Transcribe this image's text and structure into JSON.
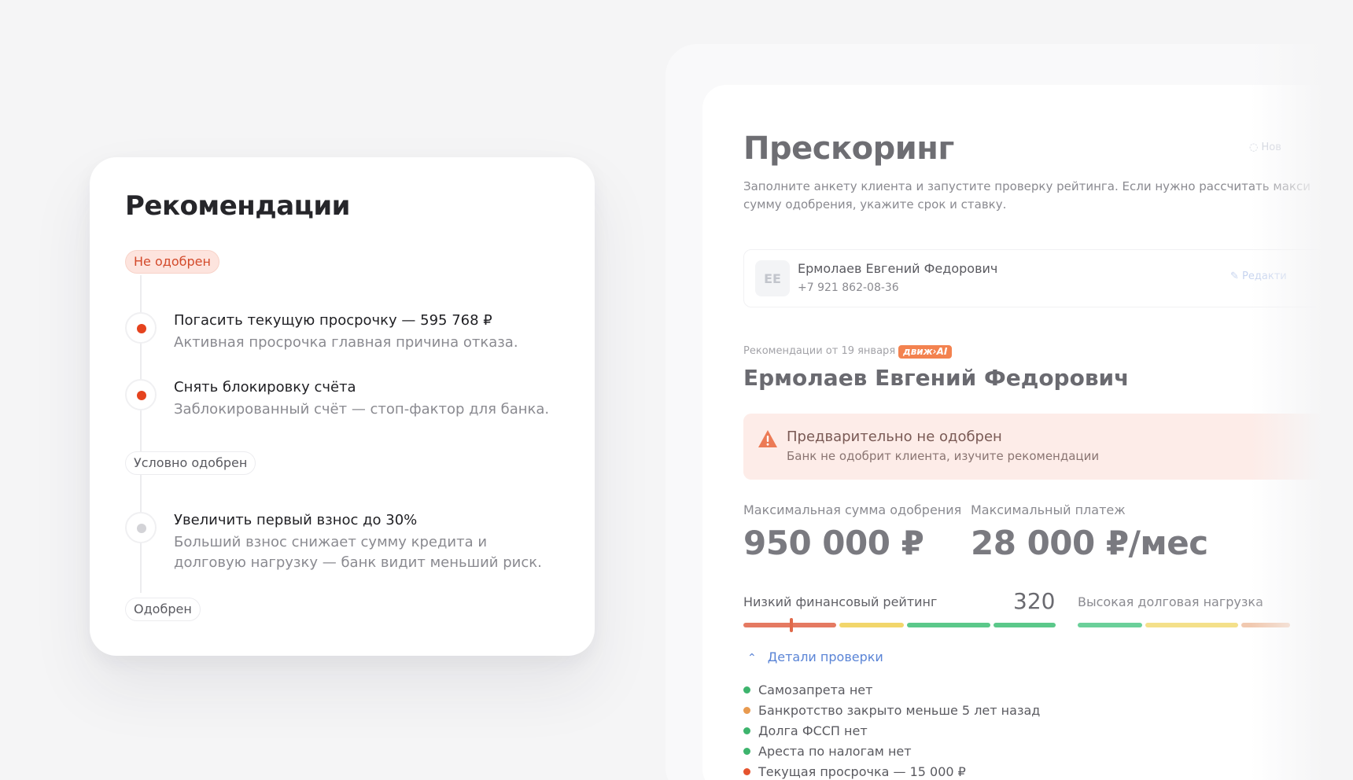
{
  "recommendations": {
    "title": "Рекомендации",
    "status_rejected": "Не одобрен",
    "steps_rejected": [
      {
        "title": "Погасить текущую просрочку — 595 768 ₽",
        "desc": "Активная просрочка главная причина отказа."
      },
      {
        "title": "Снять блокировку счёта",
        "desc": "Заблокированный счёт — стоп-фактор для банка."
      }
    ],
    "status_conditional": "Условно одобрен",
    "steps_conditional": [
      {
        "title": "Увеличить первый взнос до 30%",
        "desc": "Больший взнос снижает сумму кредита и долговую нагрузку — банк видит меньший риск."
      }
    ],
    "status_approved": "Одобрен"
  },
  "prescoring": {
    "title": "Прескоринг",
    "new_label": "Нов",
    "subtitle": "Заполните анкету клиента и запустите проверку рейтинга. Если нужно рассчитать макси сумму одобрения, укажите срок и ставку.",
    "client": {
      "initials": "ЕЕ",
      "name": "Ермолаев Евгений Федорович",
      "phone": "+7 921 862-08-36",
      "edit_label": "Редакти"
    },
    "rec_date": "Рекомендации от 19 января",
    "ai_badge": "движ›AI",
    "rec_name": "Ермолаев Евгений Федорович",
    "alert": {
      "title": "Предварительно не одобрен",
      "text": "Банк не одобрит клиента, изучите рекомендации"
    },
    "max_sum_label": "Максимальная сумма одобрения",
    "max_sum_value": "950 000 ₽",
    "max_payment_label": "Максимальный платеж",
    "max_payment_value": "28 000 ₽/мес",
    "rating_label": "Низкий финансовый рейтинг",
    "rating_value": "320",
    "debt_label": "Высокая долговая нагрузка",
    "details_label": "Детали проверки",
    "checks": [
      {
        "text": "Самозапрета нет",
        "color": "#3db46d"
      },
      {
        "text": "Банкротство закрыто меньше 5 лет назад",
        "color": "#e89a4f"
      },
      {
        "text": "Долга ФССП нет",
        "color": "#3db46d"
      },
      {
        "text": "Ареста по налогам нет",
        "color": "#3db46d"
      },
      {
        "text": "Текущая просрочка — 15 000 ₽",
        "color": "#e5532e"
      }
    ]
  },
  "colors": {
    "accent_red": "#e5431e",
    "link_blue": "#5a84d6",
    "scale_red": "#e57a62",
    "scale_yellow": "#f2d66b",
    "scale_green": "#5bc88a"
  }
}
